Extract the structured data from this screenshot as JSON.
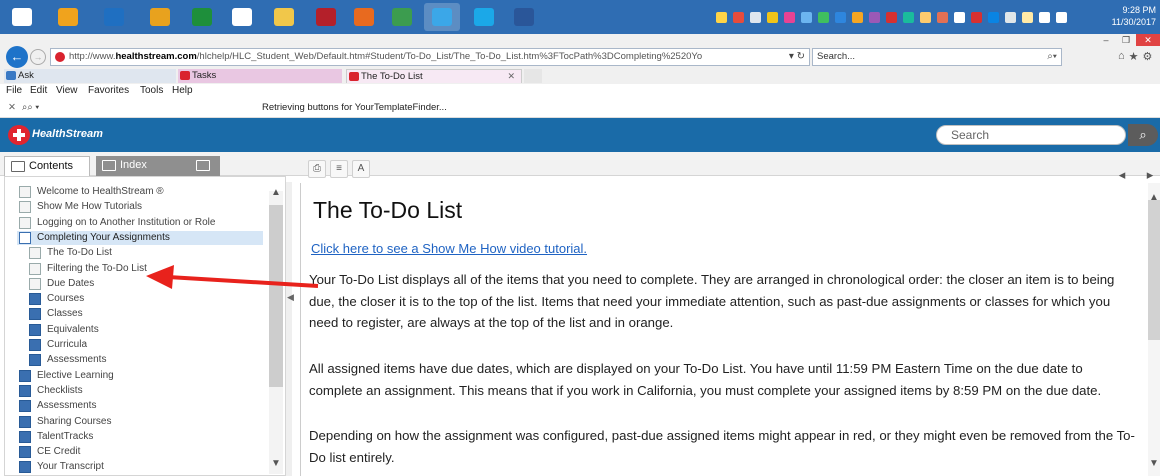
{
  "taskbar": {
    "clock_time": "9:28 PM",
    "clock_date": "11/30/2017",
    "apps": [
      {
        "name": "windows-start-icon",
        "color": "#ffffff"
      },
      {
        "name": "media-app-icon",
        "color": "#f0a31d"
      },
      {
        "name": "outlook-icon",
        "color": "#1f6fc1"
      },
      {
        "name": "paint-icon",
        "color": "#e8a21e"
      },
      {
        "name": "calculator-icon",
        "color": "#1e8f3b"
      },
      {
        "name": "amazon-icon",
        "color": "#ffffff"
      },
      {
        "name": "folder-icon",
        "color": "#f1c74a"
      },
      {
        "name": "wordpad-icon",
        "color": "#b4202a"
      },
      {
        "name": "firefox-icon",
        "color": "#e86a1f"
      },
      {
        "name": "chrome-icon",
        "color": "#3c9c4f"
      },
      {
        "name": "internet-explorer-icon",
        "color": "#3ba7e8"
      },
      {
        "name": "skype-icon",
        "color": "#1ba8e8"
      },
      {
        "name": "word-icon",
        "color": "#2a5699"
      }
    ]
  },
  "browser": {
    "address_url_prefix": "http://www.",
    "address_url_domain": "healthstream.com",
    "address_url_path": "/hlchelp/HLC_Student_Web/Default.htm#Student/To-Do_List/The_To-Do_List.htm%3FTocPath%3DCompleting%2520Yo",
    "search_placeholder": "Search...",
    "tabs": [
      {
        "label": "Ask",
        "color": "#3a79c4"
      },
      {
        "label": "Tasks",
        "color": "#d9232e"
      },
      {
        "label": "The To-Do List",
        "color": "#d9232e"
      }
    ],
    "menu": [
      "File",
      "Edit",
      "View",
      "Favorites",
      "Tools",
      "Help"
    ],
    "command_status": "Retrieving buttons for YourTemplateFinder..."
  },
  "app": {
    "brand": "HealthStream",
    "search_placeholder": "Search",
    "brand_color": "#1a6ba8",
    "left_tabs": {
      "contents": "Contents",
      "index": "Index"
    }
  },
  "toc": [
    {
      "label": "Welcome to HealthStream ®",
      "icon": "page-icon",
      "indent": 0
    },
    {
      "label": "Show Me How Tutorials",
      "icon": "page-icon",
      "indent": 0
    },
    {
      "label": "Logging on to Another Institution or Role",
      "icon": "page-icon",
      "indent": 0
    },
    {
      "label": "Completing Your Assignments",
      "icon": "open-book-icon",
      "indent": 0,
      "active": true
    },
    {
      "label": "The To-Do List",
      "icon": "page-icon",
      "indent": 1
    },
    {
      "label": "Filtering the To-Do List",
      "icon": "page-icon",
      "indent": 1
    },
    {
      "label": "Due Dates",
      "icon": "page-icon",
      "indent": 1
    },
    {
      "label": "Courses",
      "icon": "book-icon",
      "indent": 1
    },
    {
      "label": "Classes",
      "icon": "book-icon",
      "indent": 1
    },
    {
      "label": "Equivalents",
      "icon": "book-icon",
      "indent": 1
    },
    {
      "label": "Curricula",
      "icon": "book-icon",
      "indent": 1
    },
    {
      "label": "Assessments",
      "icon": "book-icon",
      "indent": 1
    },
    {
      "label": "Elective Learning",
      "icon": "book-icon",
      "indent": 0
    },
    {
      "label": "Checklists",
      "icon": "book-icon",
      "indent": 0
    },
    {
      "label": "Assessments",
      "icon": "book-icon",
      "indent": 0
    },
    {
      "label": "Sharing Courses",
      "icon": "book-icon",
      "indent": 0
    },
    {
      "label": "TalentTracks",
      "icon": "book-icon",
      "indent": 0
    },
    {
      "label": "CE Credit",
      "icon": "book-icon",
      "indent": 0
    },
    {
      "label": "Your Transcript",
      "icon": "book-icon",
      "indent": 0
    }
  ],
  "content": {
    "title": "The To-Do List",
    "video_link": "Click here to see a Show Me How video tutorial.",
    "paragraphs": [
      "Your To-Do List displays all of the items that you need to complete. They are arranged in chronological order: the closer an item is to being due, the closer it is to the top of the list. Items that need your immediate attention, such as past-due assignments or classes for which you need to register, are always at the top of the list and in orange.",
      "All assigned items have due dates, which are displayed on your To-Do List. You have until 11:59 PM Eastern Time on the due date to complete an assignment. This means that if you work in California, you must complete your assigned items by 8:59 PM on the due date.",
      "Depending on how the assignment was configured, past-due assigned items might appear in red, or they might even be removed from the To-Do list entirely."
    ]
  },
  "annotation_arrow_color": "#e8221c"
}
